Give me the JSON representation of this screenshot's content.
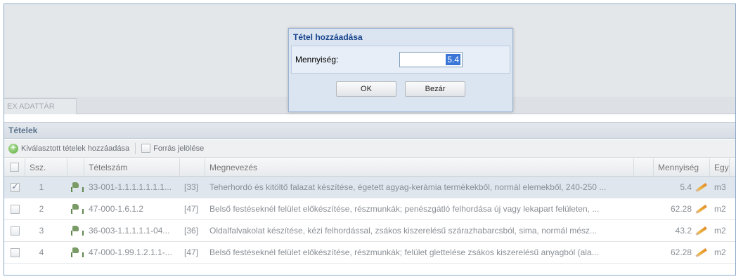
{
  "tab": {
    "label": "EX ADATTÁR"
  },
  "panel": {
    "title": "Tételek"
  },
  "toolbar": {
    "add_selected_label": "Kiválasztott tételek hozzáadása",
    "source_mark_label": "Forrás jelölése"
  },
  "columns": {
    "ssz": "Ssz.",
    "tetelszam": "Tételszám",
    "megnevezes": "Megnevezés",
    "mennyiseg": "Mennyiség",
    "egyseg": "Egy"
  },
  "rows": [
    {
      "ssz": "1",
      "tetelszam": "33-001-1.1.1.1.1.1.1...",
      "code": "[33]",
      "megnevezes": "Teherhordó és kitöltő falazat készítése, égetett agyag-kerámia termékekből, normál elemekből, 240-250 ...",
      "mennyiseg": "5.4",
      "egyseg": "m3",
      "checked": true
    },
    {
      "ssz": "2",
      "tetelszam": "47-000-1.6.1.2",
      "code": "[47]",
      "megnevezes": "Belső festéseknél felület előkészítése, részmunkák; penészgátló felhordása új vagy lekapart felületen, ...",
      "mennyiseg": "62.28",
      "egyseg": "m2",
      "checked": false
    },
    {
      "ssz": "3",
      "tetelszam": "36-003-1.1.1.1.1-04...",
      "code": "[36]",
      "megnevezes": "Oldalfalvakolat készítése, kézi felhordással, zsákos kiszerelésű szárazhabarcsból, sima, normál mész...",
      "mennyiseg": "43.2",
      "egyseg": "m2",
      "checked": false
    },
    {
      "ssz": "4",
      "tetelszam": "47-000-1.99.1.2.1.1-...",
      "code": "[47]",
      "megnevezes": "Belső festéseknél felület előkészítése, részmunkák; felület glettelése zsákos kiszerelésű anyagból (ala...",
      "mennyiseg": "62.28",
      "egyseg": "m2",
      "checked": false
    }
  ],
  "dialog": {
    "title": "Tétel hozzáadása",
    "field_label": "Mennyiség:",
    "field_value": "5.4",
    "ok_label": "OK",
    "close_label": "Bezár"
  },
  "colors": {
    "dialog_title": "#15428b",
    "selection": "#3875d7",
    "row_selected": "#dfe6ee"
  }
}
